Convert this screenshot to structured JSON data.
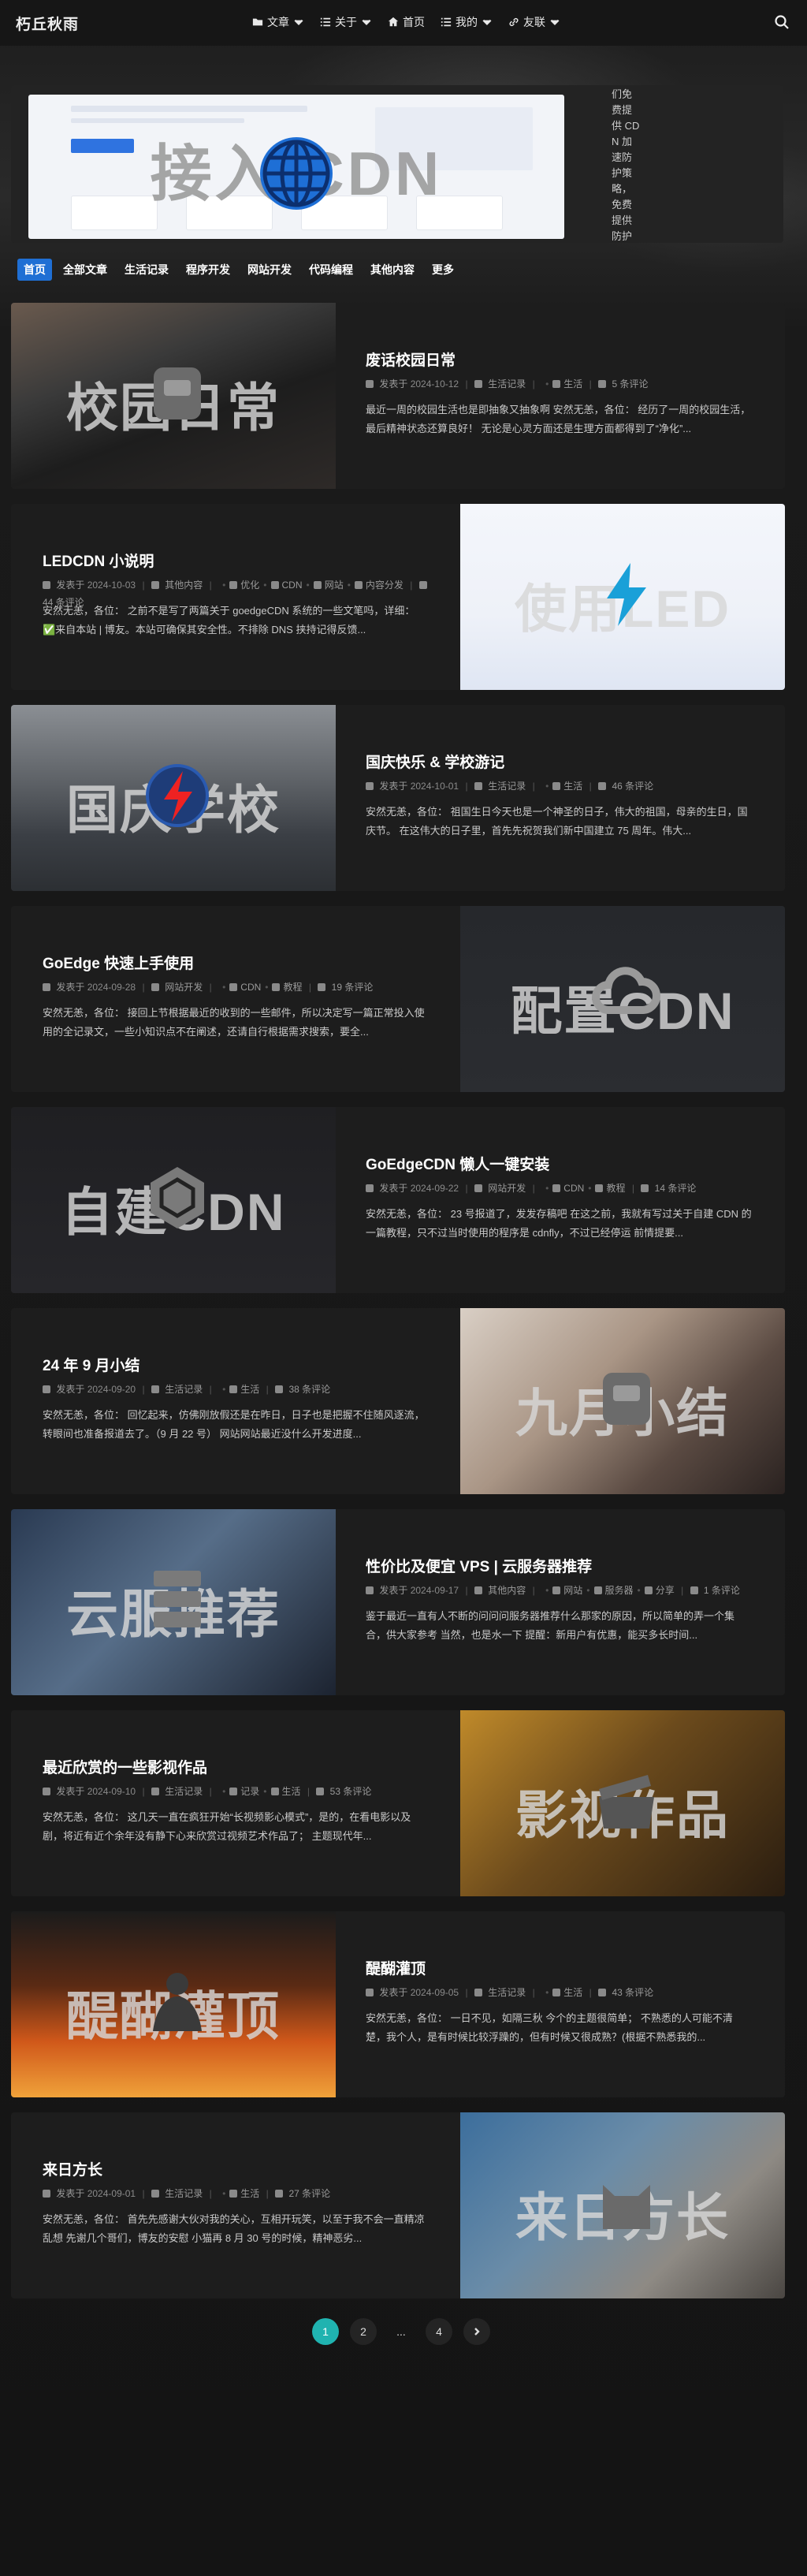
{
  "site": {
    "logo": "朽丘秋雨"
  },
  "nav": [
    {
      "label": "文章",
      "icon": "folder-icon",
      "dropdown": true
    },
    {
      "label": "关于",
      "icon": "list-icon",
      "dropdown": true
    },
    {
      "label": "首页",
      "icon": "home-icon",
      "dropdown": false
    },
    {
      "label": "我的",
      "icon": "list-icon",
      "dropdown": true
    },
    {
      "label": "友联",
      "icon": "link-icon",
      "dropdown": true
    }
  ],
  "banner": {
    "title": "接入 CDN",
    "side_text": "们免费提供 CDN 加速防护策略，免费提供防护"
  },
  "categories": [
    {
      "label": "首页",
      "active": true
    },
    {
      "label": "全部文章",
      "active": false
    },
    {
      "label": "生活记录",
      "active": false
    },
    {
      "label": "程序开发",
      "active": false
    },
    {
      "label": "网站开发",
      "active": false
    },
    {
      "label": "代码编程",
      "active": false
    },
    {
      "label": "其他内容",
      "active": false
    },
    {
      "label": "更多",
      "active": false
    }
  ],
  "posts": [
    {
      "title": "废话校园日常",
      "date": "2024-10-12",
      "category": "生活记录",
      "tags": [
        "生活"
      ],
      "comments": "5 条评论",
      "excerpt": "最近一周的校园生活也是即抽象又抽象啊 安然无恙，各位： 经历了一周的校园生活，最后精神状态还算良好！ 无论是心灵方面还是生理方面都得到了“净化”...",
      "thumb_title": "校园日常"
    },
    {
      "title": "LEDCDN 小说明",
      "date": "2024-10-03",
      "category": "其他内容",
      "tags": [
        "优化",
        "CDN",
        "网站",
        "内容分发"
      ],
      "comments": "44 条评论",
      "excerpt": "安然无恙，各位： 之前不是写了两篇关于 goedgeCDN 系统的一些文笔吗，详细： ✅来自本站 | 博友。本站可确保其安全性。不排除 DNS 挟持记得反馈...",
      "thumb_title": "使用LED"
    },
    {
      "title": "国庆快乐 & 学校游记",
      "date": "2024-10-01",
      "category": "生活记录",
      "tags": [
        "生活"
      ],
      "comments": "46 条评论",
      "excerpt": "安然无恙，各位： 祖国生日今天也是一个神圣的日子，伟大的祖国，母亲的生日，国庆节。 在这伟大的日子里，首先先祝贺我们新中国建立 75 周年。伟大...",
      "thumb_title": "国庆学校"
    },
    {
      "title": "GoEdge 快速上手使用",
      "date": "2024-09-28",
      "category": "网站开发",
      "tags": [
        "CDN",
        "教程"
      ],
      "comments": "19 条评论",
      "excerpt": "安然无恙，各位： 接回上节根据最近的收到的一些邮件，所以决定写一篇正常投入使用的全记录文，一些小知识点不在阐述，还请自行根据需求搜索，要全...",
      "thumb_title": "配置CDN"
    },
    {
      "title": "GoEdgeCDN 懒人一键安装",
      "date": "2024-09-22",
      "category": "网站开发",
      "tags": [
        "CDN",
        "教程"
      ],
      "comments": "14 条评论",
      "excerpt": "安然无恙，各位： 23 号报道了，发发存稿吧 在这之前，我就有写过关于自建 CDN 的一篇教程，只不过当时使用的程序是 cdnfly，不过已经停运 前情提要...",
      "thumb_title": "自建CDN"
    },
    {
      "title": "24 年 9 月小结",
      "date": "2024-09-20",
      "category": "生活记录",
      "tags": [
        "生活"
      ],
      "comments": "38 条评论",
      "excerpt": "安然无恙，各位： 回忆起来，仿佛刚放假还是在昨日，日子也是把握不住随风逐流，转眼间也准备报道去了。（9 月 22 号） 网站网站最近没什么开发进度...",
      "thumb_title": "九月小结"
    },
    {
      "title": "性价比及便宜 VPS | 云服务器推荐",
      "date": "2024-09-17",
      "category": "其他内容",
      "tags": [
        "网站",
        "服务器",
        "分享"
      ],
      "comments": "1 条评论",
      "excerpt": "鉴于最近一直有人不断的问问问服务器推荐什么那家的原因，所以简单的弄一个集合，供大家参考 当然，也是水一下 提醒：新用户有优惠，能买多长时间...",
      "thumb_title": "云服推荐"
    },
    {
      "title": "最近欣赏的一些影视作品",
      "date": "2024-09-10",
      "category": "生活记录",
      "tags": [
        "记录",
        "生活"
      ],
      "comments": "53 条评论",
      "excerpt": "安然无恙，各位： 这几天一直在疯狂开始“长视频影心模式”，是的，在看电影以及剧，将近有近个余年没有静下心来欣赏过视频艺术作品了； 主题现代年...",
      "thumb_title": "影视作品"
    },
    {
      "title": "醍醐灌顶",
      "date": "2024-09-05",
      "category": "生活记录",
      "tags": [
        "生活"
      ],
      "comments": "43 条评论",
      "excerpt": "安然无恙，各位： 一日不见，如隔三秋 今个的主题很简单； 不熟悉的人可能不清楚，我个人，是有时候比较浮躁的，但有时候又很成熟？(根据不熟悉我的...",
      "thumb_title": "醍醐灌顶"
    },
    {
      "title": "来日方长",
      "date": "2024-09-01",
      "category": "生活记录",
      "tags": [
        "生活"
      ],
      "comments": "27 条评论",
      "excerpt": "安然无恙，各位： 首先先感谢大伙对我的关心，互相开玩笑，以至于我不会一直精凉乱想 先谢几个哥们，博友的安慰 小猫再 8 月 30 号的时候，精神恶劣...",
      "thumb_title": "来日方长"
    }
  ],
  "meta_labels": {
    "posted": "发表于"
  },
  "pagination": {
    "pages": [
      "1",
      "2",
      "...",
      "4"
    ],
    "current": "1"
  },
  "colors": {
    "accent": "#1f6fd4",
    "pager_active": "#20b3b0",
    "card_bg": "#1d1d1d"
  }
}
